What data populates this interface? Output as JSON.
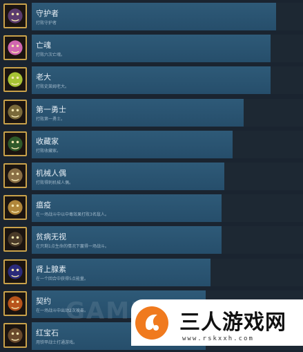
{
  "achievements": [
    {
      "title": "守护者",
      "desc": "打败守护者",
      "progress": 0.9,
      "icon": "guardian-icon",
      "color": "#5b3b6e"
    },
    {
      "title": "亡魂",
      "desc": "打败六次亡魂。",
      "progress": 0.88,
      "icon": "ghost-icon",
      "color": "#d066b0"
    },
    {
      "title": "老大",
      "desc": "打败史莱姆老大。",
      "progress": 0.88,
      "icon": "slime-king-icon",
      "color": "#a6c234"
    },
    {
      "title": "第一勇士",
      "desc": "打败第一勇士。",
      "progress": 0.78,
      "icon": "champion-icon",
      "color": "#7a6a3a"
    },
    {
      "title": "收藏家",
      "desc": "打败收藏家。",
      "progress": 0.74,
      "icon": "collector-icon",
      "color": "#2f5a2a"
    },
    {
      "title": "机械人偶",
      "desc": "打败得刺机械人偶。",
      "progress": 0.71,
      "icon": "puppet-icon",
      "color": "#8a6f45"
    },
    {
      "title": "瘟疫",
      "desc": "在一场战斗中以中毒效果打败3名敌人。",
      "progress": 0.7,
      "icon": "plague-icon",
      "color": "#b0863a"
    },
    {
      "title": "贫病无视",
      "desc": "在只剩1点生命的情况下赢得一场战斗。",
      "progress": 0.7,
      "icon": "indifferent-icon",
      "color": "#4a3a28"
    },
    {
      "title": "肾上腺素",
      "desc": "在一个回合中获得5点能量。",
      "progress": 0.66,
      "icon": "adrenaline-icon",
      "color": "#2a2a7a"
    },
    {
      "title": "契约",
      "desc": "在一场战斗中出动2次攻击。",
      "progress": 0.64,
      "icon": "pact-icon",
      "color": "#b8541c"
    },
    {
      "title": "红宝石",
      "desc": "用铁甲战士打通游戏。",
      "progress": 0.64,
      "icon": "ruby-icon",
      "color": "#6a4a2c"
    }
  ],
  "watermark": "GAMERSKY",
  "brand": {
    "name": "三人游戏网",
    "url": "www.rskxxh.com",
    "logo_color": "#f07a1e"
  }
}
